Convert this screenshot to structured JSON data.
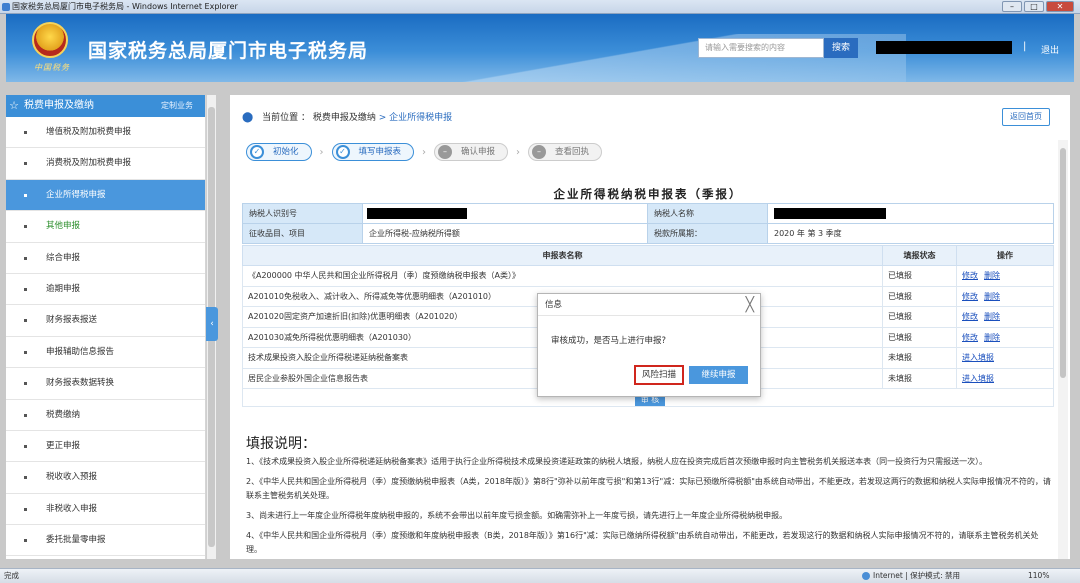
{
  "window": {
    "title": "国家税务总局厦门市电子税务局 - Windows Internet Explorer",
    "buttons": [
      "–",
      "□",
      "✕"
    ]
  },
  "header": {
    "emblem_text": "中国税务",
    "site_title": "国家税务总局厦门市电子税务局",
    "search_placeholder": "请输入需要搜索的内容",
    "search_button": "搜索",
    "separator": "|",
    "logout": "退出"
  },
  "sidebar": {
    "header": "税费申报及缴纳",
    "custom": "定制业务",
    "items": [
      {
        "label": "增值税及附加税费申报",
        "state": "normal"
      },
      {
        "label": "消费税及附加税费申报",
        "state": "normal"
      },
      {
        "label": "企业所得税申报",
        "state": "active"
      },
      {
        "label": "其他申报",
        "state": "green"
      },
      {
        "label": "综合申报",
        "state": "normal"
      },
      {
        "label": "逾期申报",
        "state": "normal"
      },
      {
        "label": "财务报表报送",
        "state": "normal"
      },
      {
        "label": "申报辅助信息报告",
        "state": "normal"
      },
      {
        "label": "财务报表数据转换",
        "state": "normal"
      },
      {
        "label": "税费缴纳",
        "state": "normal"
      },
      {
        "label": "更正申报",
        "state": "normal"
      },
      {
        "label": "税收收入预报",
        "state": "normal"
      },
      {
        "label": "非税收入申报",
        "state": "normal"
      },
      {
        "label": "委托批量零申报",
        "state": "normal"
      }
    ],
    "collapse_icon": "‹"
  },
  "main": {
    "breadcrumb": {
      "prefix": "当前位置 ：",
      "path": "税费申报及缴纳",
      "current": " > 企业所得税申报"
    },
    "home_button": "返回首页",
    "steps": [
      {
        "label": "初始化",
        "icon": "✓",
        "done": true
      },
      {
        "label": "填写申报表",
        "icon": "✓",
        "done": true
      },
      {
        "label": "确认申报",
        "icon": "–",
        "done": false
      },
      {
        "label": "查看回执",
        "icon": "–",
        "done": false
      }
    ],
    "step_arrow": "›",
    "form_title": "企业所得税纳税申报表（季报）",
    "info": {
      "taxpayer_id_label": "纳税人识别号",
      "taxpayer_name_label": "纳税人名称",
      "item_label": "征收品目、项目",
      "item_value": "企业所得税-应纳税所得额",
      "period_label": "税款所属期：",
      "period_value": "2020 年 第 3 季度"
    },
    "table": {
      "headers": [
        "申报表名称",
        "填报状态",
        "操作"
      ],
      "rows": [
        {
          "name": "《A200000 中华人民共和国企业所得税月（季）度预缴纳税申报表（A类）》",
          "status": "已填报",
          "actions": [
            "修改",
            "删除"
          ]
        },
        {
          "name": "A201010免税收入、减计收入、所得减免等优惠明细表（A201010）",
          "status": "已填报",
          "actions": [
            "修改",
            "删除"
          ]
        },
        {
          "name": "A201020固定资产加速折旧(扣除)优惠明细表（A201020）",
          "status": "已填报",
          "actions": [
            "修改",
            "删除"
          ]
        },
        {
          "name": "A201030减免所得税优惠明细表（A201030）",
          "status": "已填报",
          "actions": [
            "修改",
            "删除"
          ]
        },
        {
          "name": "技术成果投资入股企业所得税递延纳税备案表",
          "status": "未填报",
          "actions": [
            "进入填报"
          ]
        },
        {
          "name": "居民企业参股外国企业信息报告表",
          "status": "未填报",
          "actions": [
            "进入填报"
          ]
        }
      ]
    },
    "audit_button": "审 核",
    "notes_title": "填报说明：",
    "notes": [
      "1、《技术成果投资入股企业所得税递延纳税备案表》适用于执行企业所得税技术成果投资递延政策的纳税人填报，纳税人应在投资完成后首次预缴申报时向主管税务机关报送本表（同一投资行为只需报送一次）。",
      "2、《中华人民共和国企业所得税月（季）度预缴纳税申报表（A类，2018年版）》第8行\"弥补以前年度亏损\"和第13行\"减：实际已预缴所得税额\"由系统自动带出，不能更改，若发现这两行的数据和纳税人实际申报情况不符的，请联系主管税务机关处理。",
      "3、尚未进行上一年度企业所得税年度纳税申报的，系统不会带出以前年度亏损金额。如确需弥补上一年度亏损，请先进行上一年度企业所得税纳税申报。",
      "4、《中华人民共和国企业所得税月（季）度预缴和年度纳税申报表（B类，2018年版）》第16行\"减：实际已缴纳所得税额\"由系统自动带出，不能更改，若发现这行的数据和纳税人实际申报情况不符的，请联系主管税务机关处理。"
    ]
  },
  "dialog": {
    "title": "信息",
    "close": "╳",
    "message": "审核成功，是否马上进行申报?",
    "btn_scan": "风险扫描",
    "btn_continue": "继续申报"
  },
  "statusbar": {
    "left": "完成",
    "zone": "Internet | 保护模式: 禁用",
    "zoom": "110%"
  }
}
